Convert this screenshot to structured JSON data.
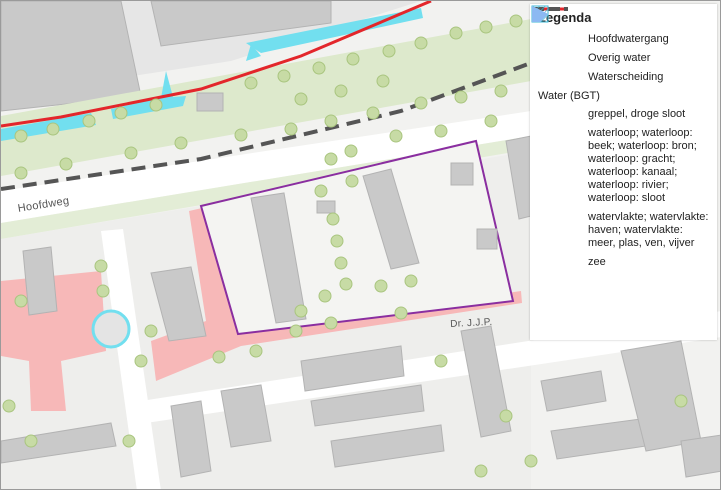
{
  "map": {
    "street_labels": {
      "hoofdweg": "Hoofdweg",
      "dr": "Dr. J.J.P."
    },
    "colors": {
      "background": "#f2f2f0",
      "road": "#ffffff",
      "building": "#c9c9c9",
      "building_stroke": "#b3b3b3",
      "green": "#dde9cc",
      "tree": "#c7dba5",
      "tree_stroke": "#a9c57f",
      "other_water": "#f7b8b8",
      "channel": "#72dfef",
      "hoofdwatergang": "#e3262b",
      "waterscheiding": "#555555",
      "parcel_outline": "#8a2ea0"
    }
  },
  "legend": {
    "title": "Legenda",
    "items": [
      {
        "label": "Hoofdwatergang",
        "symbol": "red-line-icon"
      },
      {
        "label": "Overig water",
        "symbol": "pink-polygon-icon"
      },
      {
        "label": "Waterscheiding",
        "symbol": "dashed-line-icon"
      }
    ],
    "section_title": "Water (BGT)",
    "bgt_items": [
      {
        "label": "greppel, droge sloot",
        "symbol": "hatched-square-icon"
      },
      {
        "label": "waterloop; waterloop: beek; waterloop: bron; waterloop: gracht; waterloop: kanaal; waterloop: rivier; waterloop: sloot",
        "symbol": "cyan-polygon-icon"
      },
      {
        "label": "watervlakte; watervlakte: haven; watervlakte: meer, plas, ven, vijver",
        "symbol": "lightblue-polygon-icon"
      },
      {
        "label": "zee",
        "symbol": "blue-polygon-icon"
      }
    ]
  }
}
